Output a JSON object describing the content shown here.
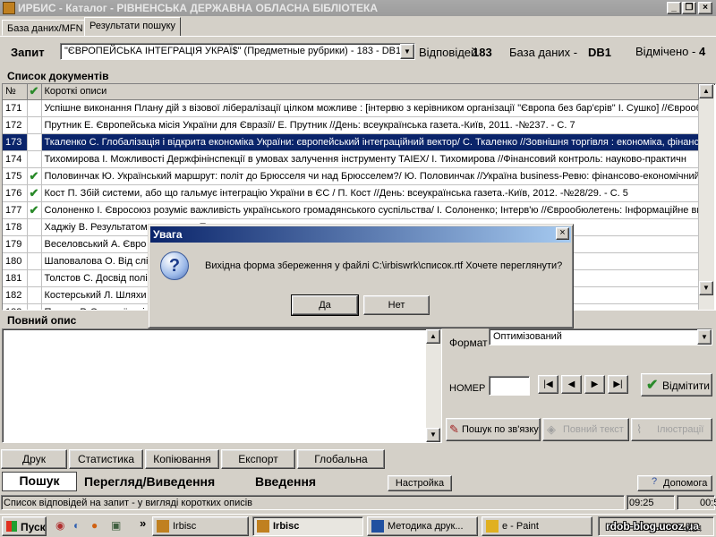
{
  "window": {
    "title": "ИРБИС - Каталог - РІВНЕНСЬКА ДЕРЖАВНА ОБЛАСНА БІБЛІОТЕКА",
    "min": "_",
    "max": "❐",
    "close": "×"
  },
  "tabs": [
    {
      "label": "База даних/MFN"
    },
    {
      "label": "Результати пошуку"
    }
  ],
  "query": {
    "label": "Запит",
    "value": "\"ЄВРОПЕЙСЬКА ІНТЕГРАЦІЯ УКРАЇ$\" (Предметные рубрики) - 183 - DB1",
    "answers_label": "Відповідей",
    "answers_count": "183",
    "db_label": "База даних -",
    "db_value": "DB1",
    "marked_label": "Відмічено -",
    "marked_count": "4"
  },
  "doclist": {
    "title": "Список документів",
    "col_num": "№",
    "col_check": "✔",
    "col_desc": "Короткі описи",
    "rows": [
      {
        "num": "171",
        "checked": "",
        "desc": "Успішне виконання Плану дій з візової лібералізації цілком можливе : [інтервю з керівником організації \"Європа без бар'єрів\" І. Сушко] //Єврообл"
      },
      {
        "num": "172",
        "checked": "",
        "desc": "Прутник Е. Європейська місія України для Євразії/ Е. Прутник //День: всеукраїнська газета.-Київ, 2011. -№237. -  С. 7"
      },
      {
        "num": "173",
        "checked": "✔",
        "desc": "Ткаленко С. Глобалізація і відкрита економіка України: європейський інтеграційний вектор/ С. Ткаленко //Зовнішня торгівля : економіка, фінанси"
      },
      {
        "num": "174",
        "checked": "",
        "desc": "Тихомирова І. Можливості Держфінінспекції в умовах залучення інструменту TAIEX/ І. Тихомирова //Фінансовий контроль: науково-практичн"
      },
      {
        "num": "175",
        "checked": "✔",
        "desc": "Половинчак Ю. Український маршрут: політ до Брюсселя чи над Брюсселем?/ Ю. Половинчак //Україна business-Ревю: фінансово-економічний"
      },
      {
        "num": "176",
        "checked": "✔",
        "desc": "Кост П. Збій системи, або що гальмує інтеграцію України в ЄС / П. Кост //День: всеукраїнська газета.-Київ, 2012. -№28/29. -  С. 5"
      },
      {
        "num": "177",
        "checked": "✔",
        "desc": "Солоненко І. Євросоюз розуміє важливість українського громадянського суспільства/ І. Солоненко; Інтерв'ю //Єврообюлетень: Інформаційне ви"
      },
      {
        "num": "178",
        "checked": "",
        "desc": "Хаджіу В. Результатом                                                                                                    е видання Представницт"
      },
      {
        "num": "179",
        "checked": "",
        "desc": "Веселовський А. Євро                                                                                                  тичний журнал.-К, 2012. -N"
      },
      {
        "num": "180",
        "checked": "",
        "desc": "Шаповалова О. Від слі                                                                                                 справи: Суспільно-політи"
      },
      {
        "num": "181",
        "checked": "",
        "desc": "Толстов С. Досвід полі                                                                                                олітичний журнал.-К, 2012."
      },
      {
        "num": "182",
        "checked": "",
        "desc": "Костерський Л. Шляхи                                                                                                  23 берез./. -  С. 5"
      },
      {
        "num": "183",
        "checked": "",
        "desc": "Петров Р. Європеїзаці                                                                                                 стосування фундаментал"
      }
    ]
  },
  "full_desc": {
    "title": "Повний опис"
  },
  "format": {
    "label": "Формат",
    "value": "Оптимізований"
  },
  "nomer": {
    "label": "НОМЕР",
    "value": ""
  },
  "nav": {
    "first": "|◀",
    "prev": "◀",
    "next": "▶",
    "last": "▶|"
  },
  "mark_button": "Відмітити",
  "links": {
    "search_link": "Пошук по зв'язку",
    "full_text": "Повний текст",
    "illustrations": "Ілюстрації"
  },
  "actions": [
    "Друк",
    "Статистика",
    "Копіювання",
    "Експорт",
    "Глобальна"
  ],
  "modes": {
    "search": "Пошук",
    "view": "Перегляд/Виведення",
    "input": "Введення",
    "settings": "Настройка",
    "help": "Допомога"
  },
  "status": {
    "text": "Список відповідей на запит - у вигляді коротких описів",
    "time1": "09:25",
    "time2": "00:50"
  },
  "dialog": {
    "title": "Увага",
    "icon": "?",
    "message": "Вихідна форма збереження у файлі  C:\\irbiswrk\\список.rtf  Хочете переглянути?",
    "yes": "Да",
    "no": "Нет"
  },
  "taskbar": {
    "start": "Пуск",
    "arrows": "»",
    "items": [
      "Irbisc",
      "Irbisc",
      "Методика друк...",
      "e - Paint"
    ],
    "clock": "9:24",
    "watermark": "rdob-blog.ucoz.ua"
  }
}
